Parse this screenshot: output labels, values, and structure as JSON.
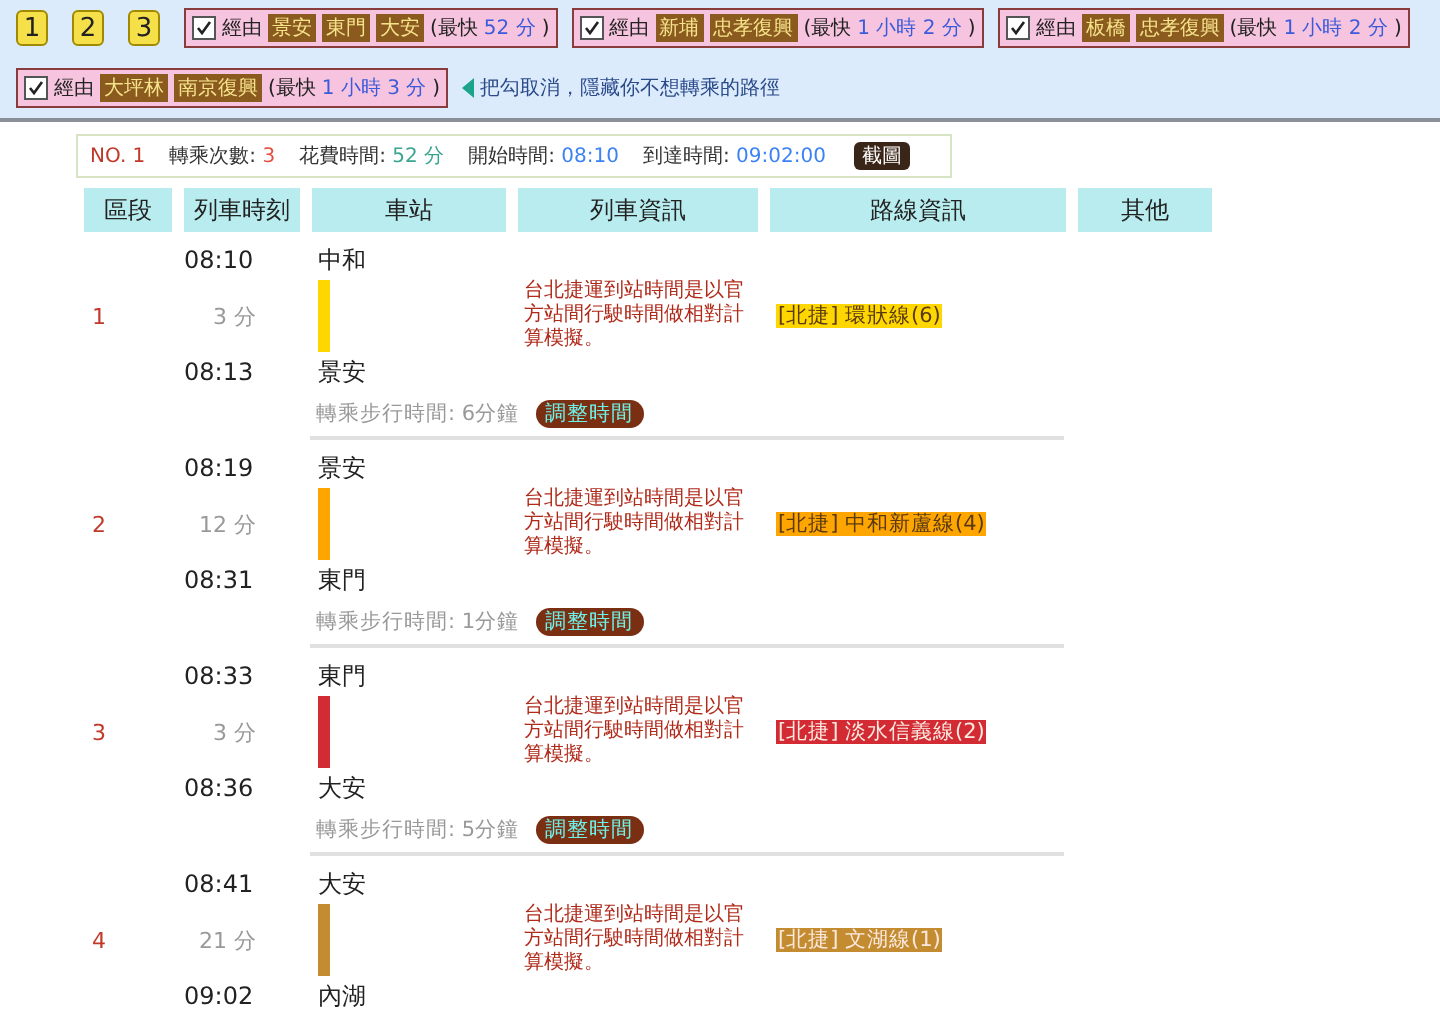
{
  "route_buttons": [
    {
      "label": "1",
      "selected": false
    },
    {
      "label": "2",
      "selected": false
    },
    {
      "label": "3",
      "selected": false
    }
  ],
  "route_filters": [
    {
      "checked": true,
      "via": "經由",
      "stations": [
        "景安",
        "東門",
        "大安"
      ],
      "fastest_prefix": "(最快",
      "fastest": "52 分",
      "fastest_suffix": ")"
    },
    {
      "checked": true,
      "via": "經由",
      "stations": [
        "新埔",
        "忠孝復興"
      ],
      "fastest_prefix": "(最快",
      "fastest": "1 小時 2 分",
      "fastest_suffix": ")"
    },
    {
      "checked": true,
      "via": "經由",
      "stations": [
        "板橋",
        "忠孝復興"
      ],
      "fastest_prefix": "(最快",
      "fastest": "1 小時 2 分",
      "fastest_suffix": ")"
    },
    {
      "checked": true,
      "via": "經由",
      "stations": [
        "大坪林",
        "南京復興"
      ],
      "fastest_prefix": "(最快",
      "fastest": "1 小時 3 分",
      "fastest_suffix": ")"
    }
  ],
  "filter_hint": "把勾取消，隱藏你不想轉乘的路徑",
  "summary": {
    "stats": [
      {
        "value": "NO. 1",
        "color": "#c0392b"
      },
      {
        "label": "轉乘次數:",
        "value": "3",
        "color": "#e74c3c"
      },
      {
        "label": "花費時間:",
        "value": "52 分",
        "color": "#3aa58f"
      },
      {
        "label": "開始時間:",
        "value": "08:10",
        "color": "#3b82f6"
      },
      {
        "label": "到達時間:",
        "value": "09:02:00",
        "color": "#3b82f6"
      }
    ],
    "button": "截圖"
  },
  "table": {
    "columns": [
      "區段",
      "列車時刻",
      "車站",
      "列車資訊",
      "路線資訊",
      "其他"
    ],
    "segments": [
      {
        "index": "1",
        "depart": "08:10",
        "duration": "3 分",
        "arrive": "08:13",
        "from": "中和",
        "to": "景安",
        "color": "#ffd700",
        "info": "台北捷運到站時間是以官方站間行駛時間做相對計算模擬。",
        "route": "[北捷] 環狀線(6)",
        "transfer": {
          "label": "轉乘步行時間: 6分鐘",
          "button": "調整時間"
        }
      },
      {
        "index": "2",
        "depart": "08:19",
        "duration": "12 分",
        "arrive": "08:31",
        "from": "景安",
        "to": "東門",
        "color": "#ffa500",
        "info": "台北捷運到站時間是以官方站間行駛時間做相對計算模擬。",
        "route": "[北捷] 中和新蘆線(4)",
        "transfer": {
          "label": "轉乘步行時間: 1分鐘",
          "button": "調整時間"
        }
      },
      {
        "index": "3",
        "depart": "08:33",
        "duration": "3 分",
        "arrive": "08:36",
        "from": "東門",
        "to": "大安",
        "color": "#d22b34",
        "info": "台北捷運到站時間是以官方站間行駛時間做相對計算模擬。",
        "route": "[北捷] 淡水信義線(2)",
        "transfer": {
          "label": "轉乘步行時間: 5分鐘",
          "button": "調整時間"
        }
      },
      {
        "index": "4",
        "depart": "08:41",
        "duration": "21 分",
        "arrive": "09:02",
        "from": "大安",
        "to": "內湖",
        "color": "#c48c31",
        "info": "台北捷運到站時間是以官方站間行駛時間做相對計算模擬。",
        "route": "[北捷] 文湖線(1)"
      }
    ]
  }
}
